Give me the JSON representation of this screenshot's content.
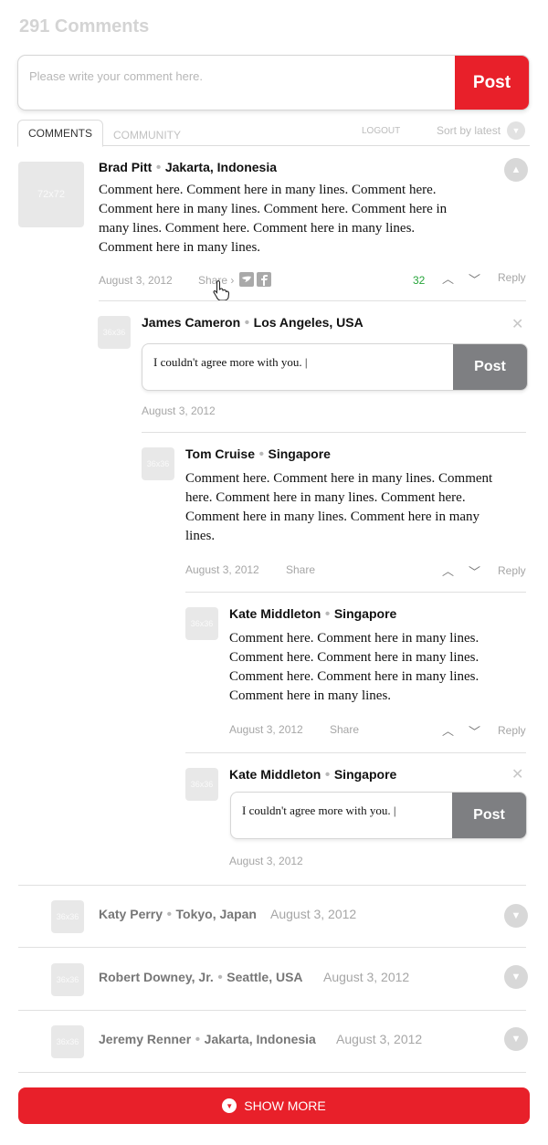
{
  "header": {
    "title": "291 Comments"
  },
  "composer": {
    "placeholder": "Please write your comment here.",
    "post_label": "Post"
  },
  "tabs": {
    "comments": "COMMENTS",
    "community": "COMMUNITY",
    "logout": "LOGOUT",
    "sort": "Sort by latest"
  },
  "comments": [
    {
      "author": "Brad Pitt",
      "location": "Jakarta, Indonesia",
      "avatar_label": "72x72",
      "body": [
        "Comment here. Comment here in many lines. Comment here.",
        "Comment here in many lines. Comment here. Comment here in",
        "many lines. Comment here. Comment here in many lines.",
        "Comment here in many lines."
      ],
      "date": "August 3, 2012",
      "share": "Share",
      "votes": "32",
      "reply": "Reply"
    }
  ],
  "reply1": {
    "author": "James Cameron",
    "location": "Los Angeles, USA",
    "avatar_label": "36x36",
    "text": "I couldn't agree more with you. |",
    "post_label": "Post",
    "date": "August 3, 2012"
  },
  "nested1": {
    "author": "Tom Cruise",
    "location": "Singapore",
    "avatar_label": "36x36",
    "body": [
      "Comment here. Comment here in many lines. Comment",
      "here. Comment here in many lines. Comment here.",
      "Comment here in many lines. Comment here in many",
      "lines."
    ],
    "date": "August 3, 2012",
    "share": "Share",
    "reply": "Reply"
  },
  "nested2": {
    "author": "Kate Middleton",
    "location": "Singapore",
    "avatar_label": "36x36",
    "body": [
      "Comment here. Comment here in many lines.",
      "Comment here. Comment here in many lines.",
      "Comment here. Comment here in many lines.",
      "Comment here in many lines."
    ],
    "date": "August 3, 2012",
    "share": "Share",
    "reply": "Reply"
  },
  "reply2": {
    "author": "Kate Middleton",
    "location": "Singapore",
    "avatar_label": "36x36",
    "text": "I couldn't agree more with you. |",
    "post_label": "Post",
    "date": "August 3, 2012"
  },
  "collapsed": [
    {
      "author": "Katy Perry",
      "location": "Tokyo, Japan",
      "date": "August 3, 2012",
      "avatar_label": "36x36"
    },
    {
      "author": "Robert Downey, Jr.",
      "location": "Seattle, USA",
      "date": "August 3, 2012",
      "avatar_label": "36x36"
    },
    {
      "author": "Jeremy Renner",
      "location": "Jakarta, Indonesia",
      "date": "August 3, 2012",
      "avatar_label": "36x36"
    }
  ],
  "footer": {
    "show_more": "SHOW MORE"
  },
  "colors": {
    "accent": "#e8202a",
    "post_gray": "#7e7f82",
    "vote_green": "#27a53b"
  },
  "icons": {
    "social": [
      "twitter-icon",
      "facebook-icon"
    ],
    "cursor": "hand-pointer-icon"
  }
}
